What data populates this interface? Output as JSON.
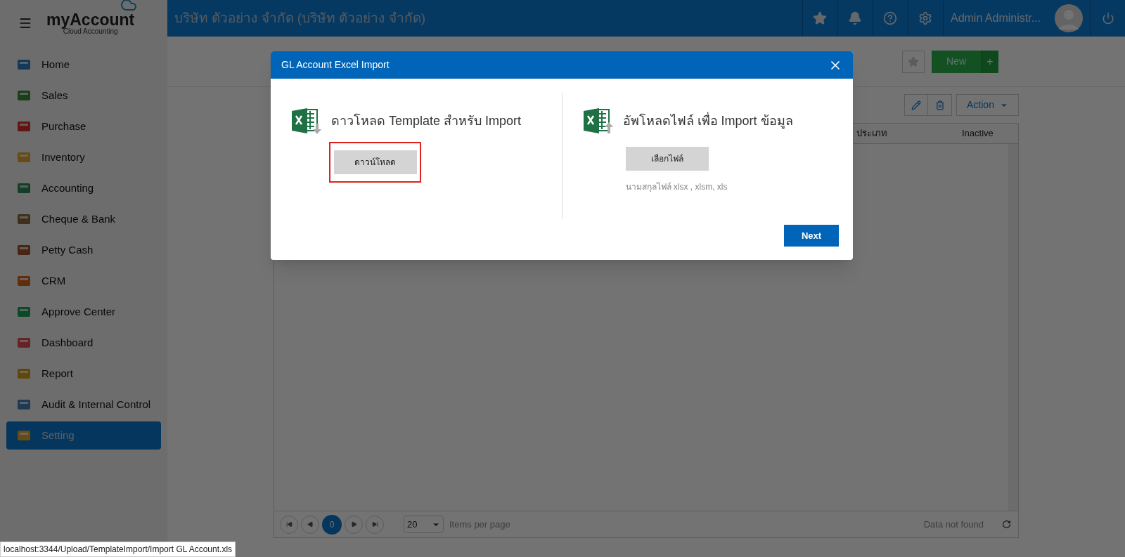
{
  "header": {
    "company": "บริษัท ตัวอย่าง จำกัด (บริษัท ตัวอย่าง จำกัด)",
    "user": "Admin Administr..."
  },
  "logo": {
    "name": "myAccount",
    "tagline": "Cloud Accounting"
  },
  "sidebar": {
    "items": [
      {
        "label": "Home",
        "selected": false
      },
      {
        "label": "Sales",
        "selected": false
      },
      {
        "label": "Purchase",
        "selected": false
      },
      {
        "label": "Inventory",
        "selected": false
      },
      {
        "label": "Accounting",
        "selected": false
      },
      {
        "label": "Cheque & Bank",
        "selected": false
      },
      {
        "label": "Petty Cash",
        "selected": false
      },
      {
        "label": "CRM",
        "selected": false
      },
      {
        "label": "Approve Center",
        "selected": false
      },
      {
        "label": "Dashboard",
        "selected": false
      },
      {
        "label": "Report",
        "selected": false
      },
      {
        "label": "Audit & Internal Control",
        "selected": false
      },
      {
        "label": "Setting",
        "selected": true
      }
    ]
  },
  "toolbar": {
    "new_button": "New",
    "add_button": "+",
    "action_button": "Action"
  },
  "table": {
    "columns": [
      "ประเภท",
      "Inactive"
    ]
  },
  "pagination": {
    "page": "0",
    "page_size": "20",
    "page_size_label": "Items per page",
    "status": "Data not found"
  },
  "modal": {
    "title": "GL Account Excel Import",
    "download": {
      "heading": "ดาวโหลด Template สำหรับ Import",
      "button": "ดาวน์โหลด",
      "highlighted": true
    },
    "upload": {
      "heading": "อัพโหลดไฟล์ เพื่อ Import ข้อมูล",
      "button": "เลือกไฟล์",
      "hint": "นามสกุลไฟล์ xlsx , xlsm, xls"
    },
    "next_button": "Next"
  },
  "status_url": "localhost:3344/Upload/TemplateImport/Import GL Account.xls"
}
